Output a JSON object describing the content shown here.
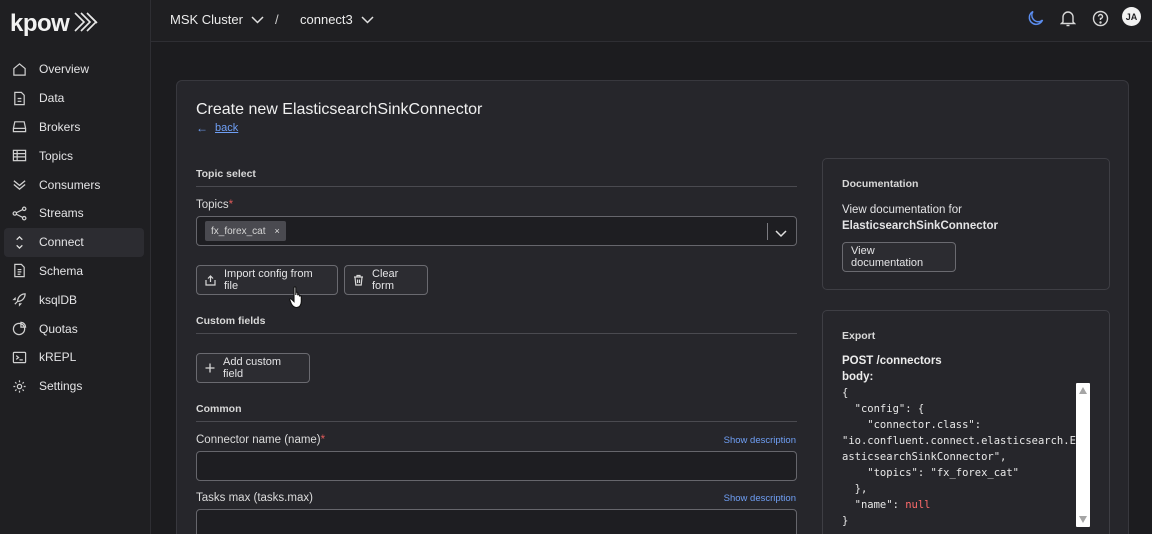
{
  "app": {
    "logo_text": "kpow"
  },
  "sidebar": {
    "items": [
      {
        "label": "Overview",
        "icon": "home-icon"
      },
      {
        "label": "Data",
        "icon": "document-icon"
      },
      {
        "label": "Brokers",
        "icon": "server-icon"
      },
      {
        "label": "Topics",
        "icon": "table-icon"
      },
      {
        "label": "Consumers",
        "icon": "double-chevron-icon"
      },
      {
        "label": "Streams",
        "icon": "share-icon"
      },
      {
        "label": "Connect",
        "icon": "connect-icon",
        "active": true
      },
      {
        "label": "Schema",
        "icon": "schema-icon"
      },
      {
        "label": "ksqlDB",
        "icon": "rocket-icon"
      },
      {
        "label": "Quotas",
        "icon": "pie-icon"
      },
      {
        "label": "kREPL",
        "icon": "terminal-icon"
      },
      {
        "label": "Settings",
        "icon": "gear-icon"
      }
    ]
  },
  "topbar": {
    "cluster": "MSK Cluster",
    "separator": "/",
    "connect": "connect3",
    "user_initials": "JA"
  },
  "form": {
    "title": "Create new ElasticsearchSinkConnector",
    "back_arrow": "←",
    "back_label": "back",
    "topic_select_label": "Topic select",
    "topics_label": "Topics",
    "required_mark": "*",
    "selected_topic": "fx_forex_cat",
    "chip_remove": "×",
    "import_button": "Import config from file",
    "clear_button": "Clear form",
    "custom_fields_label": "Custom fields",
    "add_custom_field_button": "Add custom field",
    "common_label": "Common",
    "connector_name_label": "Connector name (name)",
    "tasks_max_label": "Tasks max (tasks.max)",
    "show_description": "Show description",
    "connector_name_value": "",
    "tasks_max_value": ""
  },
  "documentation": {
    "title": "Documentation",
    "text": "View documentation for",
    "connector": "ElasticsearchSinkConnector",
    "button": "View documentation"
  },
  "export": {
    "title": "Export",
    "method_path": "POST /connectors",
    "body_label": "body:",
    "code_lines": [
      "{",
      "  \"config\": {",
      "    \"connector.class\":",
      "\"io.confluent.connect.elasticsearch.El",
      "asticsearchSinkConnector\",",
      "    \"topics\": \"fx_forex_cat\"",
      "  },",
      "  \"name\": null",
      "}"
    ]
  },
  "colors": {
    "accent_link": "#6f9ff5",
    "required": "#e05a5a",
    "null_value": "#ff6b6b",
    "moon_icon": "#5b8def"
  }
}
